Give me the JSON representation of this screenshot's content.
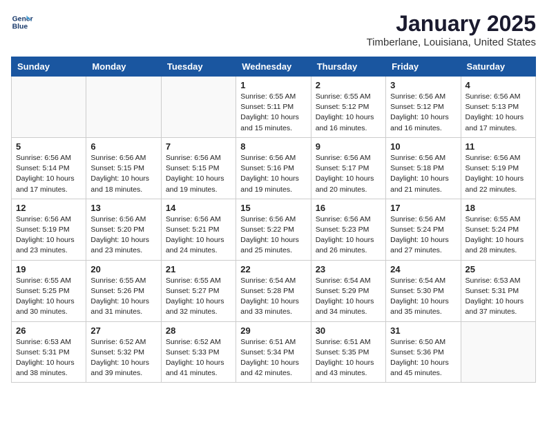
{
  "header": {
    "logo_line1": "General",
    "logo_line2": "Blue",
    "month": "January 2025",
    "location": "Timberlane, Louisiana, United States"
  },
  "weekdays": [
    "Sunday",
    "Monday",
    "Tuesday",
    "Wednesday",
    "Thursday",
    "Friday",
    "Saturday"
  ],
  "weeks": [
    [
      {
        "day": "",
        "info": ""
      },
      {
        "day": "",
        "info": ""
      },
      {
        "day": "",
        "info": ""
      },
      {
        "day": "1",
        "info": "Sunrise: 6:55 AM\nSunset: 5:11 PM\nDaylight: 10 hours\nand 15 minutes."
      },
      {
        "day": "2",
        "info": "Sunrise: 6:55 AM\nSunset: 5:12 PM\nDaylight: 10 hours\nand 16 minutes."
      },
      {
        "day": "3",
        "info": "Sunrise: 6:56 AM\nSunset: 5:12 PM\nDaylight: 10 hours\nand 16 minutes."
      },
      {
        "day": "4",
        "info": "Sunrise: 6:56 AM\nSunset: 5:13 PM\nDaylight: 10 hours\nand 17 minutes."
      }
    ],
    [
      {
        "day": "5",
        "info": "Sunrise: 6:56 AM\nSunset: 5:14 PM\nDaylight: 10 hours\nand 17 minutes."
      },
      {
        "day": "6",
        "info": "Sunrise: 6:56 AM\nSunset: 5:15 PM\nDaylight: 10 hours\nand 18 minutes."
      },
      {
        "day": "7",
        "info": "Sunrise: 6:56 AM\nSunset: 5:15 PM\nDaylight: 10 hours\nand 19 minutes."
      },
      {
        "day": "8",
        "info": "Sunrise: 6:56 AM\nSunset: 5:16 PM\nDaylight: 10 hours\nand 19 minutes."
      },
      {
        "day": "9",
        "info": "Sunrise: 6:56 AM\nSunset: 5:17 PM\nDaylight: 10 hours\nand 20 minutes."
      },
      {
        "day": "10",
        "info": "Sunrise: 6:56 AM\nSunset: 5:18 PM\nDaylight: 10 hours\nand 21 minutes."
      },
      {
        "day": "11",
        "info": "Sunrise: 6:56 AM\nSunset: 5:19 PM\nDaylight: 10 hours\nand 22 minutes."
      }
    ],
    [
      {
        "day": "12",
        "info": "Sunrise: 6:56 AM\nSunset: 5:19 PM\nDaylight: 10 hours\nand 23 minutes."
      },
      {
        "day": "13",
        "info": "Sunrise: 6:56 AM\nSunset: 5:20 PM\nDaylight: 10 hours\nand 23 minutes."
      },
      {
        "day": "14",
        "info": "Sunrise: 6:56 AM\nSunset: 5:21 PM\nDaylight: 10 hours\nand 24 minutes."
      },
      {
        "day": "15",
        "info": "Sunrise: 6:56 AM\nSunset: 5:22 PM\nDaylight: 10 hours\nand 25 minutes."
      },
      {
        "day": "16",
        "info": "Sunrise: 6:56 AM\nSunset: 5:23 PM\nDaylight: 10 hours\nand 26 minutes."
      },
      {
        "day": "17",
        "info": "Sunrise: 6:56 AM\nSunset: 5:24 PM\nDaylight: 10 hours\nand 27 minutes."
      },
      {
        "day": "18",
        "info": "Sunrise: 6:55 AM\nSunset: 5:24 PM\nDaylight: 10 hours\nand 28 minutes."
      }
    ],
    [
      {
        "day": "19",
        "info": "Sunrise: 6:55 AM\nSunset: 5:25 PM\nDaylight: 10 hours\nand 30 minutes."
      },
      {
        "day": "20",
        "info": "Sunrise: 6:55 AM\nSunset: 5:26 PM\nDaylight: 10 hours\nand 31 minutes."
      },
      {
        "day": "21",
        "info": "Sunrise: 6:55 AM\nSunset: 5:27 PM\nDaylight: 10 hours\nand 32 minutes."
      },
      {
        "day": "22",
        "info": "Sunrise: 6:54 AM\nSunset: 5:28 PM\nDaylight: 10 hours\nand 33 minutes."
      },
      {
        "day": "23",
        "info": "Sunrise: 6:54 AM\nSunset: 5:29 PM\nDaylight: 10 hours\nand 34 minutes."
      },
      {
        "day": "24",
        "info": "Sunrise: 6:54 AM\nSunset: 5:30 PM\nDaylight: 10 hours\nand 35 minutes."
      },
      {
        "day": "25",
        "info": "Sunrise: 6:53 AM\nSunset: 5:31 PM\nDaylight: 10 hours\nand 37 minutes."
      }
    ],
    [
      {
        "day": "26",
        "info": "Sunrise: 6:53 AM\nSunset: 5:31 PM\nDaylight: 10 hours\nand 38 minutes."
      },
      {
        "day": "27",
        "info": "Sunrise: 6:52 AM\nSunset: 5:32 PM\nDaylight: 10 hours\nand 39 minutes."
      },
      {
        "day": "28",
        "info": "Sunrise: 6:52 AM\nSunset: 5:33 PM\nDaylight: 10 hours\nand 41 minutes."
      },
      {
        "day": "29",
        "info": "Sunrise: 6:51 AM\nSunset: 5:34 PM\nDaylight: 10 hours\nand 42 minutes."
      },
      {
        "day": "30",
        "info": "Sunrise: 6:51 AM\nSunset: 5:35 PM\nDaylight: 10 hours\nand 43 minutes."
      },
      {
        "day": "31",
        "info": "Sunrise: 6:50 AM\nSunset: 5:36 PM\nDaylight: 10 hours\nand 45 minutes."
      },
      {
        "day": "",
        "info": ""
      }
    ]
  ]
}
